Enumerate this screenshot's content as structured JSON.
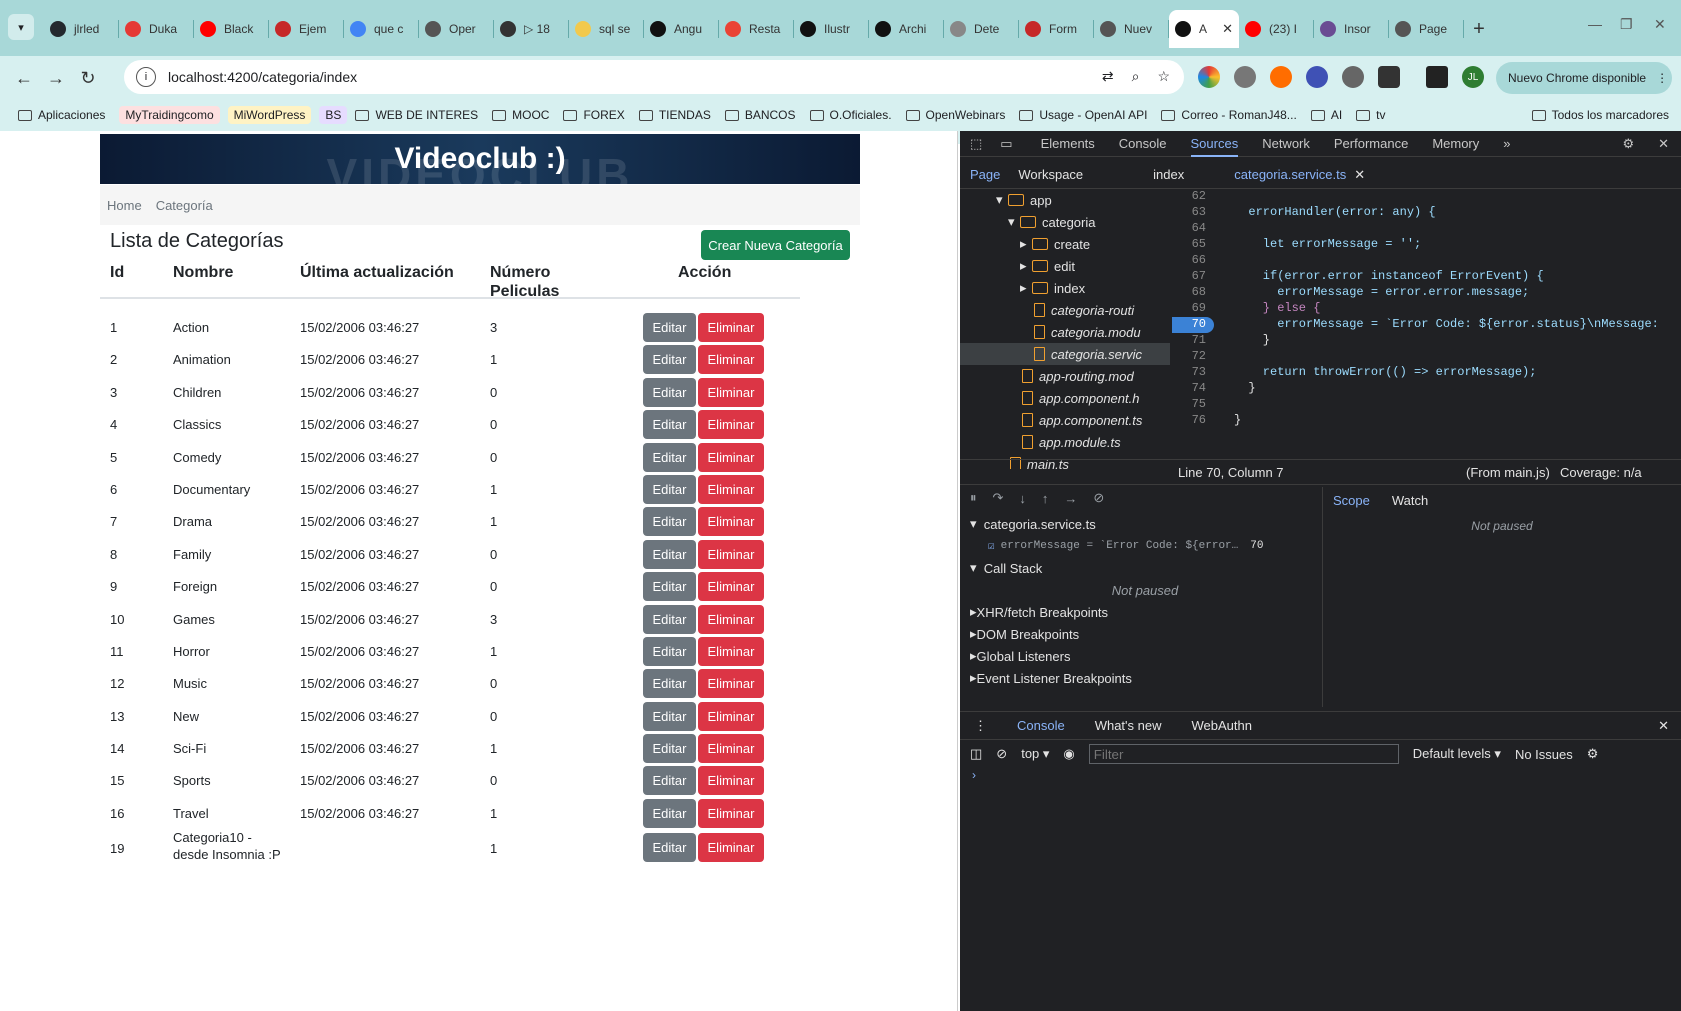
{
  "browser": {
    "tabs": [
      {
        "label": "jlrled",
        "color": "#24292e",
        "active": false
      },
      {
        "label": "Duka",
        "color": "#e53935",
        "active": false
      },
      {
        "label": "Black",
        "color": "#ff0000",
        "active": false
      },
      {
        "label": "Ejem",
        "color": "#c62828",
        "active": false
      },
      {
        "label": "que c",
        "color": "#4285f4",
        "active": false
      },
      {
        "label": "Oper",
        "color": "#555555",
        "active": false
      },
      {
        "label": "▷ 18",
        "color": "#333333",
        "active": false
      },
      {
        "label": "sql se",
        "color": "#f2c94c",
        "active": false
      },
      {
        "label": "Angu",
        "color": "#111111",
        "active": false
      },
      {
        "label": "Resta",
        "color": "#ea4335",
        "active": false
      },
      {
        "label": "Ilustr",
        "color": "#111111",
        "active": false
      },
      {
        "label": "Archi",
        "color": "#111111",
        "active": false
      },
      {
        "label": "Dete",
        "color": "#888888",
        "active": false
      },
      {
        "label": "Form",
        "color": "#c62828",
        "active": false
      },
      {
        "label": "Nuev",
        "color": "#555555",
        "active": false
      },
      {
        "label": "A",
        "color": "#111111",
        "active": true
      },
      {
        "label": "(23) I",
        "color": "#ff0000",
        "active": false
      },
      {
        "label": "Insor",
        "color": "#6a4c93",
        "active": false
      },
      {
        "label": "Page",
        "color": "#555555",
        "active": false
      }
    ],
    "new_tab": "+",
    "url": "localhost:4200/categoria/index",
    "chrome_update": "Nuevo Chrome disponible",
    "bookmarks": [
      "Aplicaciones",
      "MyTraidingcomo",
      "MiWordPress",
      "BS",
      "WEB DE INTERES",
      "MOOC",
      "FOREX",
      "TIENDAS",
      "BANCOS",
      "O.Oficiales.",
      "OpenWebinars",
      "Usage - OpenAI API",
      "Correo - RomanJ48...",
      "AI",
      "tv",
      "Todos los marcadores"
    ],
    "avatar": "JL"
  },
  "app": {
    "banner_title": "Videoclub :)",
    "banner_ghost": "VIDEOCLUB",
    "breadcrumb": [
      "Home",
      "Categoría"
    ],
    "list_title": "Lista de Categorías",
    "create_button": "Crear Nueva Categoría",
    "headers": {
      "id": "Id",
      "nombre": "Nombre",
      "updated": "Última actualización",
      "num_l1": "Número",
      "num_l2": "Peliculas",
      "action": "Acción"
    },
    "edit_label": "Editar",
    "delete_label": "Eliminar",
    "rows": [
      {
        "id": "1",
        "nombre": "Action",
        "fecha": "15/02/2006 03:46:27",
        "num": "3"
      },
      {
        "id": "2",
        "nombre": "Animation",
        "fecha": "15/02/2006 03:46:27",
        "num": "1"
      },
      {
        "id": "3",
        "nombre": "Children",
        "fecha": "15/02/2006 03:46:27",
        "num": "0"
      },
      {
        "id": "4",
        "nombre": "Classics",
        "fecha": "15/02/2006 03:46:27",
        "num": "0"
      },
      {
        "id": "5",
        "nombre": "Comedy",
        "fecha": "15/02/2006 03:46:27",
        "num": "0"
      },
      {
        "id": "6",
        "nombre": "Documentary",
        "fecha": "15/02/2006 03:46:27",
        "num": "1"
      },
      {
        "id": "7",
        "nombre": "Drama",
        "fecha": "15/02/2006 03:46:27",
        "num": "1"
      },
      {
        "id": "8",
        "nombre": "Family",
        "fecha": "15/02/2006 03:46:27",
        "num": "0"
      },
      {
        "id": "9",
        "nombre": "Foreign",
        "fecha": "15/02/2006 03:46:27",
        "num": "0"
      },
      {
        "id": "10",
        "nombre": "Games",
        "fecha": "15/02/2006 03:46:27",
        "num": "3"
      },
      {
        "id": "11",
        "nombre": "Horror",
        "fecha": "15/02/2006 03:46:27",
        "num": "1"
      },
      {
        "id": "12",
        "nombre": "Music",
        "fecha": "15/02/2006 03:46:27",
        "num": "0"
      },
      {
        "id": "13",
        "nombre": "New",
        "fecha": "15/02/2006 03:46:27",
        "num": "0"
      },
      {
        "id": "14",
        "nombre": "Sci-Fi",
        "fecha": "15/02/2006 03:46:27",
        "num": "1"
      },
      {
        "id": "15",
        "nombre": "Sports",
        "fecha": "15/02/2006 03:46:27",
        "num": "0"
      },
      {
        "id": "16",
        "nombre": "Travel",
        "fecha": "15/02/2006 03:46:27",
        "num": "1"
      },
      {
        "id": "19",
        "nombre": "Categoria10 - desde Insomnia :P",
        "fecha": "",
        "num": "1"
      }
    ]
  },
  "devtools": {
    "tabs": [
      "Elements",
      "Console",
      "Sources",
      "Network",
      "Performance",
      "Memory"
    ],
    "active_tab": "Sources",
    "sub_tabs": [
      "Page",
      "Workspace"
    ],
    "open_files": [
      "index",
      "categoria.service.ts"
    ],
    "tree": [
      {
        "label": "app",
        "kind": "folder",
        "depth": 3
      },
      {
        "label": "categoria",
        "kind": "folder",
        "depth": 4
      },
      {
        "label": "create",
        "kind": "folder",
        "depth": 5
      },
      {
        "label": "edit",
        "kind": "folder",
        "depth": 5
      },
      {
        "label": "index",
        "kind": "folder",
        "depth": 5
      },
      {
        "label": "categoria-routi",
        "kind": "file",
        "depth": 5
      },
      {
        "label": "categoria.modu",
        "kind": "file",
        "depth": 5
      },
      {
        "label": "categoria.servic",
        "kind": "file",
        "depth": 5
      },
      {
        "label": "app-routing.mod",
        "kind": "file",
        "depth": 4
      },
      {
        "label": "app.component.h",
        "kind": "file",
        "depth": 4
      },
      {
        "label": "app.component.ts",
        "kind": "file",
        "depth": 4
      },
      {
        "label": "app.module.ts",
        "kind": "file",
        "depth": 4
      },
      {
        "label": "main.ts",
        "kind": "file",
        "depth": 3
      }
    ],
    "code": [
      {
        "n": "62",
        "t": ""
      },
      {
        "n": "63",
        "t": "  errorHandler(error: any) {"
      },
      {
        "n": "64",
        "t": ""
      },
      {
        "n": "65",
        "t": "    let errorMessage = '';"
      },
      {
        "n": "66",
        "t": ""
      },
      {
        "n": "67",
        "t": "    if(error.error instanceof ErrorEvent) {"
      },
      {
        "n": "68",
        "t": "      errorMessage = error.error.message;"
      },
      {
        "n": "69",
        "t": "    } else {"
      },
      {
        "n": "70",
        "t": "      errorMessage = `Error Code: ${error.status}\\nMessage:"
      },
      {
        "n": "71",
        "t": "    }"
      },
      {
        "n": "72",
        "t": ""
      },
      {
        "n": "73",
        "t": "    return throwError(() => errorMessage);"
      },
      {
        "n": "74",
        "t": "  }"
      },
      {
        "n": "75",
        "t": ""
      },
      {
        "n": "76",
        "t": "}"
      }
    ],
    "breakpoint_line": "70",
    "status_position": "Line 70, Column 7",
    "status_from": "(From main.js)",
    "status_coverage": "Coverage: n/a",
    "bp_file": "categoria.service.ts",
    "bp_expr": "errorMessage = `Error Code: ${error…",
    "bp_line": "70",
    "call_stack": "Call Stack",
    "not_paused": "Not paused",
    "sections": [
      "XHR/fetch Breakpoints",
      "DOM Breakpoints",
      "Global Listeners",
      "Event Listener Breakpoints"
    ],
    "scope_tabs": [
      "Scope",
      "Watch"
    ],
    "drawer_tabs": [
      "Console",
      "What's new",
      "WebAuthn"
    ],
    "console_context": "top",
    "filter_placeholder": "Filter",
    "levels": "Default levels",
    "issues": "No Issues"
  }
}
